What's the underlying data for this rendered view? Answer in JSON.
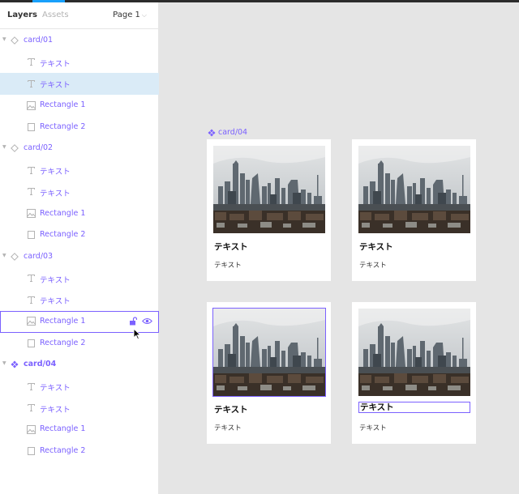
{
  "panel": {
    "tabs": {
      "layers": "Layers",
      "assets": "Assets"
    },
    "page": "Page 1"
  },
  "layers": [
    {
      "type": "component",
      "label": "card/01",
      "depth": 0
    },
    {
      "type": "text",
      "label": "テキスト",
      "depth": 1
    },
    {
      "type": "text",
      "label": "テキスト",
      "depth": 1,
      "state": "selected"
    },
    {
      "type": "image",
      "label": "Rectangle 1",
      "depth": 1
    },
    {
      "type": "rect",
      "label": "Rectangle 2",
      "depth": 1
    },
    {
      "type": "component",
      "label": "card/02",
      "depth": 0
    },
    {
      "type": "text",
      "label": "テキスト",
      "depth": 1
    },
    {
      "type": "text",
      "label": "テキスト",
      "depth": 1
    },
    {
      "type": "image",
      "label": "Rectangle 1",
      "depth": 1
    },
    {
      "type": "rect",
      "label": "Rectangle 2",
      "depth": 1
    },
    {
      "type": "component",
      "label": "card/03",
      "depth": 0
    },
    {
      "type": "text",
      "label": "テキスト",
      "depth": 1
    },
    {
      "type": "text",
      "label": "テキスト",
      "depth": 1
    },
    {
      "type": "image",
      "label": "Rectangle 1",
      "depth": 1,
      "state": "hovered"
    },
    {
      "type": "rect",
      "label": "Rectangle 2",
      "depth": 1
    },
    {
      "type": "master",
      "label": "card/04",
      "depth": 0
    },
    {
      "type": "text",
      "label": "テキスト",
      "depth": 1
    },
    {
      "type": "text",
      "label": "テキスト",
      "depth": 1
    },
    {
      "type": "image",
      "label": "Rectangle 1",
      "depth": 1
    },
    {
      "type": "rect",
      "label": "Rectangle 2",
      "depth": 1
    }
  ],
  "canvas": {
    "frame_label": "card/04",
    "cards": [
      {
        "title": "テキスト",
        "body": "テキスト"
      },
      {
        "title": "テキスト",
        "body": "テキスト"
      },
      {
        "title": "テキスト",
        "body": "テキスト"
      },
      {
        "title": "テキスト",
        "body": "テキスト"
      }
    ]
  },
  "colors": {
    "component": "#7b61ff",
    "selection_bg": "#daebf7",
    "canvas_bg": "#e5e5e5",
    "accent_blue": "#18a0fb"
  },
  "icons": {
    "component": "diamond-outline-icon",
    "master": "component-master-icon",
    "text": "text-t-icon",
    "image": "image-icon",
    "rect": "rectangle-icon",
    "lock": "unlock-icon",
    "eye": "eye-icon"
  }
}
